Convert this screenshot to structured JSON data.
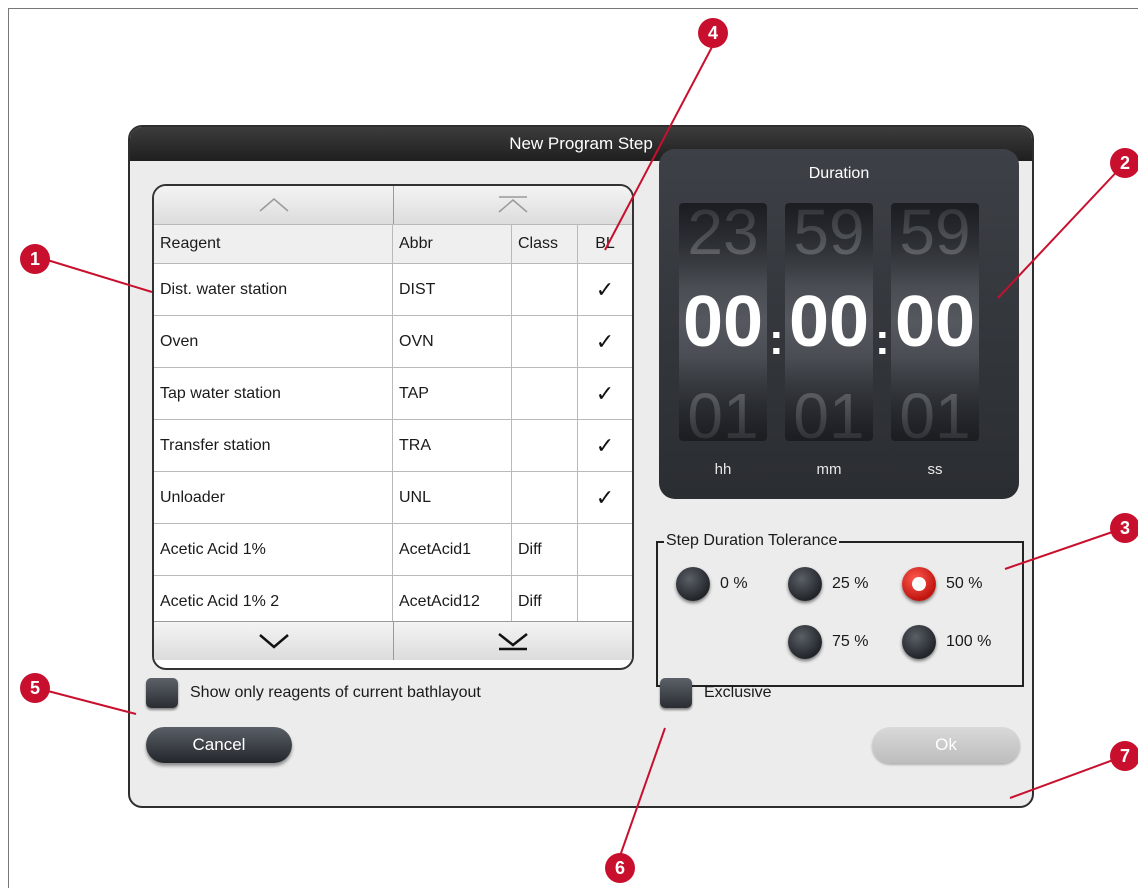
{
  "dialog": {
    "title": "New Program Step"
  },
  "table": {
    "headers": {
      "reagent": "Reagent",
      "abbr": "Abbr",
      "class": "Class",
      "bl": "BL"
    },
    "rows": [
      {
        "reagent": "Dist. water station",
        "abbr": "DIST",
        "class": "",
        "bl": "✓"
      },
      {
        "reagent": "Oven",
        "abbr": "OVN",
        "class": "",
        "bl": "✓"
      },
      {
        "reagent": "Tap water station",
        "abbr": "TAP",
        "class": "",
        "bl": "✓"
      },
      {
        "reagent": "Transfer station",
        "abbr": "TRA",
        "class": "",
        "bl": "✓"
      },
      {
        "reagent": "Unloader",
        "abbr": "UNL",
        "class": "",
        "bl": "✓"
      },
      {
        "reagent": "Acetic Acid 1%",
        "abbr": "AcetAcid1",
        "class": "Diff",
        "bl": ""
      },
      {
        "reagent": "Acetic Acid 1% 2",
        "abbr": "AcetAcid12",
        "class": "Diff",
        "bl": ""
      }
    ],
    "nav_icons": [
      "chevron-up-icon",
      "scroll-to-top-icon",
      "chevron-down-icon",
      "scroll-to-bottom-icon"
    ]
  },
  "duration": {
    "title": "Duration",
    "hours": {
      "prev": "23",
      "current": "00",
      "next": "01",
      "unit": "hh"
    },
    "minutes": {
      "prev": "59",
      "current": "00",
      "next": "01",
      "unit": "mm"
    },
    "seconds": {
      "prev": "59",
      "current": "00",
      "next": "01",
      "unit": "ss"
    },
    "separator": ":"
  },
  "tolerance": {
    "title": "Step Duration Tolerance",
    "options": [
      {
        "label": "0 %",
        "selected": false
      },
      {
        "label": "25 %",
        "selected": false
      },
      {
        "label": "50 %",
        "selected": true
      },
      {
        "label": "75 %",
        "selected": false
      },
      {
        "label": "100 %",
        "selected": false
      }
    ]
  },
  "checkboxes": {
    "show_only_bathlayout": {
      "label": "Show only reagents of current bathlayout",
      "checked": false
    },
    "exclusive": {
      "label": "Exclusive",
      "checked": false
    }
  },
  "buttons": {
    "cancel": "Cancel",
    "ok": "Ok"
  },
  "callouts": [
    "1",
    "2",
    "3",
    "4",
    "5",
    "6",
    "7"
  ],
  "colors": {
    "accent": "#c8102e",
    "dark_panel": "#2f3237",
    "dialog_bg": "#ececec"
  }
}
